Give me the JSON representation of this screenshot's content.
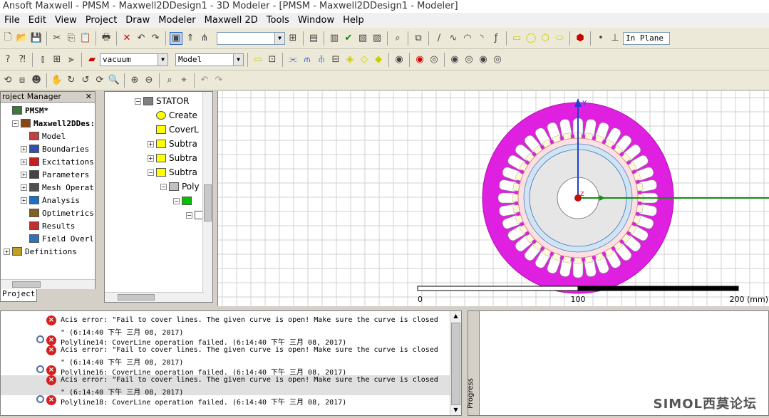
{
  "window": {
    "title": "Ansoft Maxwell - PMSM - Maxwell2DDesign1 - 3D Modeler - [PMSM - Maxwell2DDesign1 - Modeler]"
  },
  "menu": [
    "File",
    "Edit",
    "View",
    "Project",
    "Draw",
    "Modeler",
    "Maxwell 2D",
    "Tools",
    "Window",
    "Help"
  ],
  "toolbar": {
    "plane_combo": "In Plane",
    "material_combo": "vacuum",
    "model_combo": "Model",
    "snap_combo": ""
  },
  "project_manager": {
    "title": "roject Manager",
    "close_glyph": "✕",
    "tab_label": "Project",
    "tree": [
      {
        "label": "PMSM*",
        "indent": 0,
        "expander": "",
        "bold": true
      },
      {
        "label": "Maxwell2DDes:",
        "indent": 1,
        "expander": "−",
        "bold": true
      },
      {
        "label": "Model",
        "indent": 2,
        "expander": ""
      },
      {
        "label": "Boundaries",
        "indent": 2,
        "expander": "+"
      },
      {
        "label": "Excitations",
        "indent": 2,
        "expander": "+"
      },
      {
        "label": "Parameters",
        "indent": 2,
        "expander": "+"
      },
      {
        "label": "Mesh Operat",
        "indent": 2,
        "expander": "+"
      },
      {
        "label": "Analysis",
        "indent": 2,
        "expander": "+"
      },
      {
        "label": "Optimetrics",
        "indent": 2,
        "expander": ""
      },
      {
        "label": "Results",
        "indent": 2,
        "expander": ""
      },
      {
        "label": "Field Overl",
        "indent": 2,
        "expander": ""
      },
      {
        "label": "Definitions",
        "indent": 0,
        "expander": "+"
      }
    ]
  },
  "history_tree": [
    {
      "label": "STATOR",
      "indent": 0,
      "expander": "−"
    },
    {
      "label": "Create",
      "indent": 1,
      "expander": ""
    },
    {
      "label": "CoverL",
      "indent": 1,
      "expander": ""
    },
    {
      "label": "Subtra",
      "indent": 1,
      "expander": "+"
    },
    {
      "label": "Subtra",
      "indent": 1,
      "expander": "+"
    },
    {
      "label": "Subtra",
      "indent": 1,
      "expander": "−"
    },
    {
      "label": "Poly",
      "indent": 2,
      "expander": "−"
    },
    {
      "label": "",
      "indent": 3,
      "expander": "−"
    },
    {
      "label": "",
      "indent": 4,
      "expander": "−"
    }
  ],
  "viewport": {
    "axis_labels": {
      "y": "Y",
      "z": "Z"
    },
    "scale_labels": [
      "0",
      "100",
      "200 (mm)"
    ],
    "colors": {
      "stator": "#e020e0",
      "rotor": "#e6e6e6",
      "airgap": "#ffe0e0",
      "band": "#d0e4f4",
      "grid": "#d0d0d0"
    },
    "slot_count": 36
  },
  "messages": [
    {
      "kind": "error",
      "text": "Acis error: \"Fail to cover lines. The given curve is open! Make sure the curve is closed",
      "has_magnifier": false
    },
    {
      "kind": "cont",
      "text": "\" (6:14:40 下午  三月 08, 2017)"
    },
    {
      "kind": "error",
      "text": "Polyline14: CoverLine operation failed.  (6:14:40 下午  三月 08, 2017)",
      "has_magnifier": true
    },
    {
      "kind": "error",
      "text": "Acis error: \"Fail to cover lines. The given curve is open! Make sure the curve is closed",
      "has_magnifier": false
    },
    {
      "kind": "cont",
      "text": "\" (6:14:40 下午  三月 08, 2017)"
    },
    {
      "kind": "error",
      "text": "Polyline16: CoverLine operation failed.  (6:14:40 下午  三月 08, 2017)",
      "has_magnifier": true
    },
    {
      "kind": "error",
      "text": "Acis error: \"Fail to cover lines. The given curve is open! Make sure the curve is closed",
      "has_magnifier": false
    },
    {
      "kind": "cont",
      "text": "\" (6:14:40 下午  三月 08, 2017)"
    },
    {
      "kind": "error",
      "text": "Polyline18: CoverLine operation failed.  (6:14:40 下午  三月 08, 2017)",
      "has_magnifier": true
    }
  ],
  "progress": {
    "label": "Progress"
  },
  "watermark": "SIMOL西莫论坛"
}
